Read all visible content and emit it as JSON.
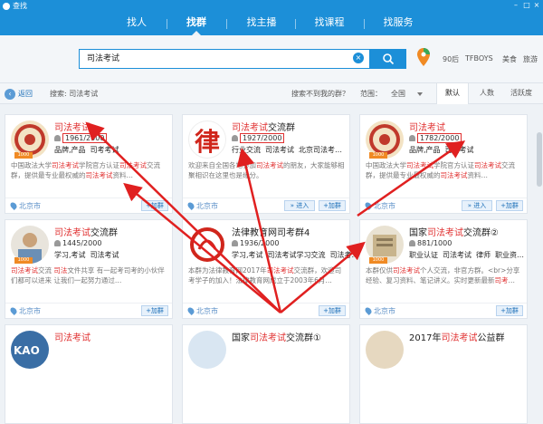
{
  "titlebar": {
    "title": "查找"
  },
  "nav": {
    "tabs": [
      "找人",
      "找群",
      "找主播",
      "找课程",
      "找服务"
    ],
    "active": 1
  },
  "search": {
    "value": "司法考试"
  },
  "hot_words": [
    "90后",
    "TFBOYS",
    "美食",
    "旅游"
  ],
  "filter": {
    "back_label": "返回",
    "breadcrumb": "搜索:  司法考试",
    "not_found": "搜索不到我的群？",
    "range_label": "范围：",
    "range_value": "全国",
    "sort_tabs": [
      "默认",
      "人数",
      "活跃度"
    ]
  },
  "cards": [
    {
      "title_hl": "司法考试",
      "title_rest": ".",
      "members": "1961/2000",
      "tags": [
        "品牌,产品",
        "司考考试"
      ],
      "desc_parts": [
        "中国政法大学",
        "司法考试",
        "学院官方认证",
        "司法考试",
        "交流群，提供最专业最权威的",
        "司法考试",
        "资料…"
      ],
      "city": "北京市",
      "join": "+加群",
      "enter": ""
    },
    {
      "title_hl": "司法考试",
      "title_rest": "交流群",
      "members": "1927/2000",
      "tags": [
        "行业交流",
        "司法考试",
        "北京司法考…"
      ],
      "desc_parts": [
        "欢迎来自全国各地参加",
        "司法考试",
        "的朋友，大家能够相聚相识在这里也是缘分。"
      ],
      "city": "北京市",
      "join": "+加群",
      "enter": "» 进入"
    },
    {
      "title_hl": "司法考试",
      "title_rest": "",
      "members": "1782/2000",
      "tags": [
        "品牌,产品",
        "司法考试"
      ],
      "desc_parts": [
        "中国政法大学",
        "司法考试",
        "学院官方认证",
        "司法考试",
        "交流群，提供最专业最权威的",
        "司法考试",
        "资料…"
      ],
      "city": "北京市",
      "join": "+加群",
      "enter": "» 进入"
    },
    {
      "title_hl": "司法考试",
      "title_rest": "交流群",
      "members": "1445/2000",
      "tags": [
        "学习,考试",
        "司法考试"
      ],
      "desc_parts": [
        "司法考试",
        "交流  ",
        "司法",
        "文件共享    有一起考司考的小伙伴们都可以进来    让我们一起努力通过…"
      ],
      "city": "北京市",
      "join": "+加群",
      "enter": ""
    },
    {
      "title_hl": "",
      "title_rest": "法律教育网司考群4",
      "members": "1936/2000",
      "tags": [
        "学习,考试",
        "司法考试学习交流",
        "司法考…"
      ],
      "desc_parts": [
        "本群为法律教育网2017年",
        "司法考试",
        "交流群，欢迎司考学子的加入！法律教育网成立于2003年6月…"
      ],
      "city": "北京市",
      "join": "+加群",
      "enter": ""
    },
    {
      "title_hl": "司法考试",
      "title_rest": "交流群②",
      "title_pre": "国家",
      "members": "881/1000",
      "tags": [
        "职业认证",
        "司法考试",
        "律师",
        "职业资…"
      ],
      "desc_parts": [
        "本群仅供",
        "司法考试",
        "个人交流，非官方群。<br>分享经验、复习资料、笔记讲义。实时更新最新",
        "司考",
        "…"
      ],
      "city": "北京市",
      "join": "+加群",
      "enter": ""
    },
    {
      "title_hl": "司法考试",
      "title_rest": "",
      "title_pre": "",
      "members": "",
      "tags": [],
      "desc_parts": [],
      "city": "",
      "join": "",
      "enter": ""
    },
    {
      "title_hl": "司法考试",
      "title_rest": "交流群①",
      "title_pre": "国家",
      "members": "",
      "tags": [],
      "desc_parts": [],
      "city": "",
      "join": "",
      "enter": ""
    },
    {
      "title_hl": "司法考试",
      "title_rest": "公益群",
      "title_pre": "2017年",
      "members": "",
      "tags": [],
      "desc_parts": [],
      "city": "",
      "join": "",
      "enter": ""
    }
  ],
  "colors": {
    "brand": "#1c8fd8",
    "highlight": "#e03030",
    "arrow": "#e02020"
  }
}
